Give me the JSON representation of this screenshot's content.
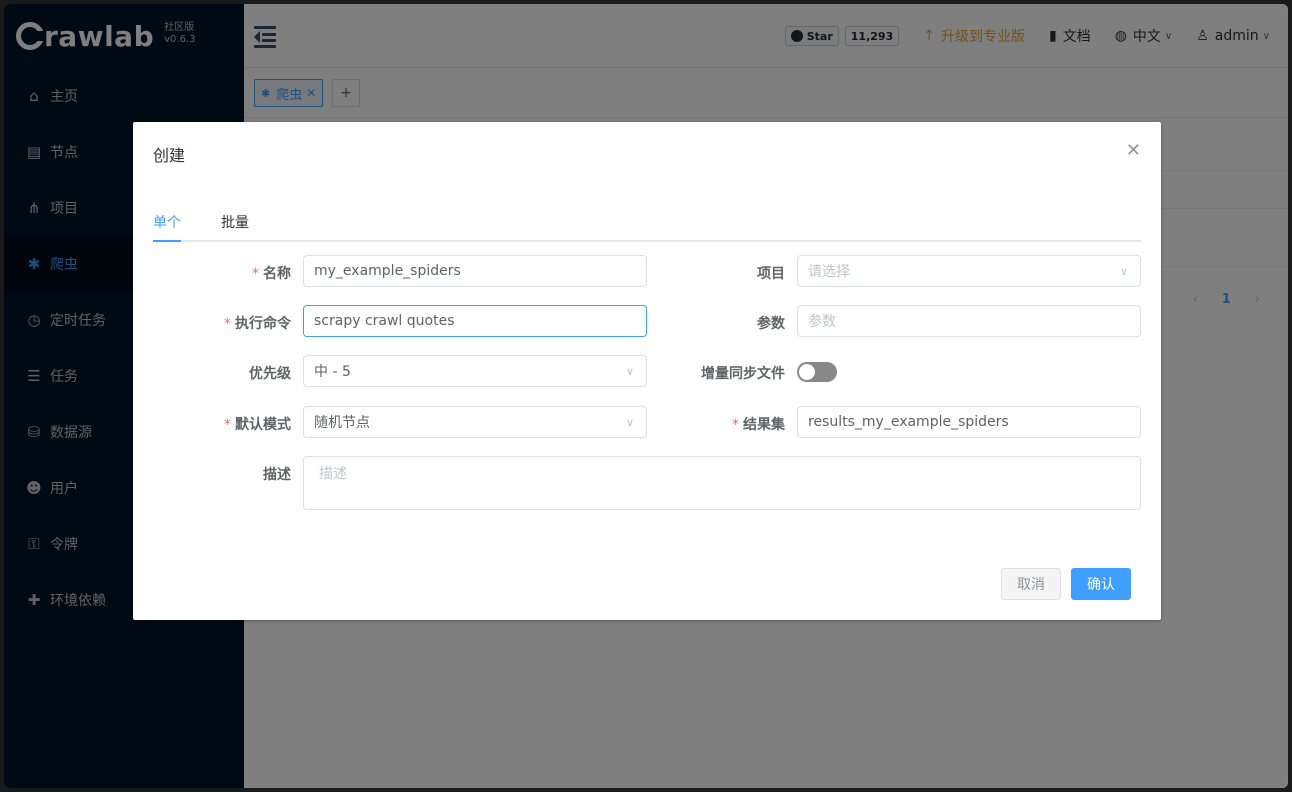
{
  "app": {
    "logo_text": "rawlab",
    "edition_line1": "社区版",
    "edition_line2": "v0.6.3"
  },
  "sidebar": {
    "items": [
      {
        "label": "主页",
        "icon": "home-icon"
      },
      {
        "label": "节点",
        "icon": "server-icon"
      },
      {
        "label": "项目",
        "icon": "project-icon"
      },
      {
        "label": "爬虫",
        "icon": "spider-icon",
        "active": true
      },
      {
        "label": "定时任务",
        "icon": "clock-icon"
      },
      {
        "label": "任务",
        "icon": "task-list-icon"
      },
      {
        "label": "数据源",
        "icon": "database-icon"
      },
      {
        "label": "用户",
        "icon": "users-icon"
      },
      {
        "label": "令牌",
        "icon": "key-icon"
      },
      {
        "label": "环境依赖",
        "icon": "puzzle-icon"
      }
    ]
  },
  "header": {
    "github_star_label": "Star",
    "github_star_count": "11,293",
    "upgrade_label": "升级到专业版",
    "docs_label": "文档",
    "language_label": "中文",
    "user_label": "admin"
  },
  "tabs_bar": {
    "active_tab_label": "爬虫",
    "add_label": "+"
  },
  "content": {
    "pager_current": "1"
  },
  "dialog": {
    "title": "创建",
    "tabs": [
      "单个",
      "批量"
    ],
    "fields": {
      "name_label": "名称",
      "name_value": "my_example_spiders",
      "project_label": "项目",
      "project_placeholder": "请选择",
      "cmd_label": "执行命令",
      "cmd_value": "scrapy crawl quotes",
      "param_label": "参数",
      "param_placeholder": "参数",
      "priority_label": "优先级",
      "priority_value": "中 - 5",
      "incremental_label": "增量同步文件",
      "incremental_on": false,
      "mode_label": "默认模式",
      "mode_value": "随机节点",
      "result_label": "结果集",
      "result_value": "results_my_example_spiders",
      "desc_label": "描述",
      "desc_placeholder": "描述"
    },
    "cancel_label": "取消",
    "confirm_label": "确认"
  },
  "colors": {
    "primary": "#409eff",
    "sidebar_bg": "#001529",
    "warning": "#e6a23c",
    "danger": "#f56c6c"
  }
}
